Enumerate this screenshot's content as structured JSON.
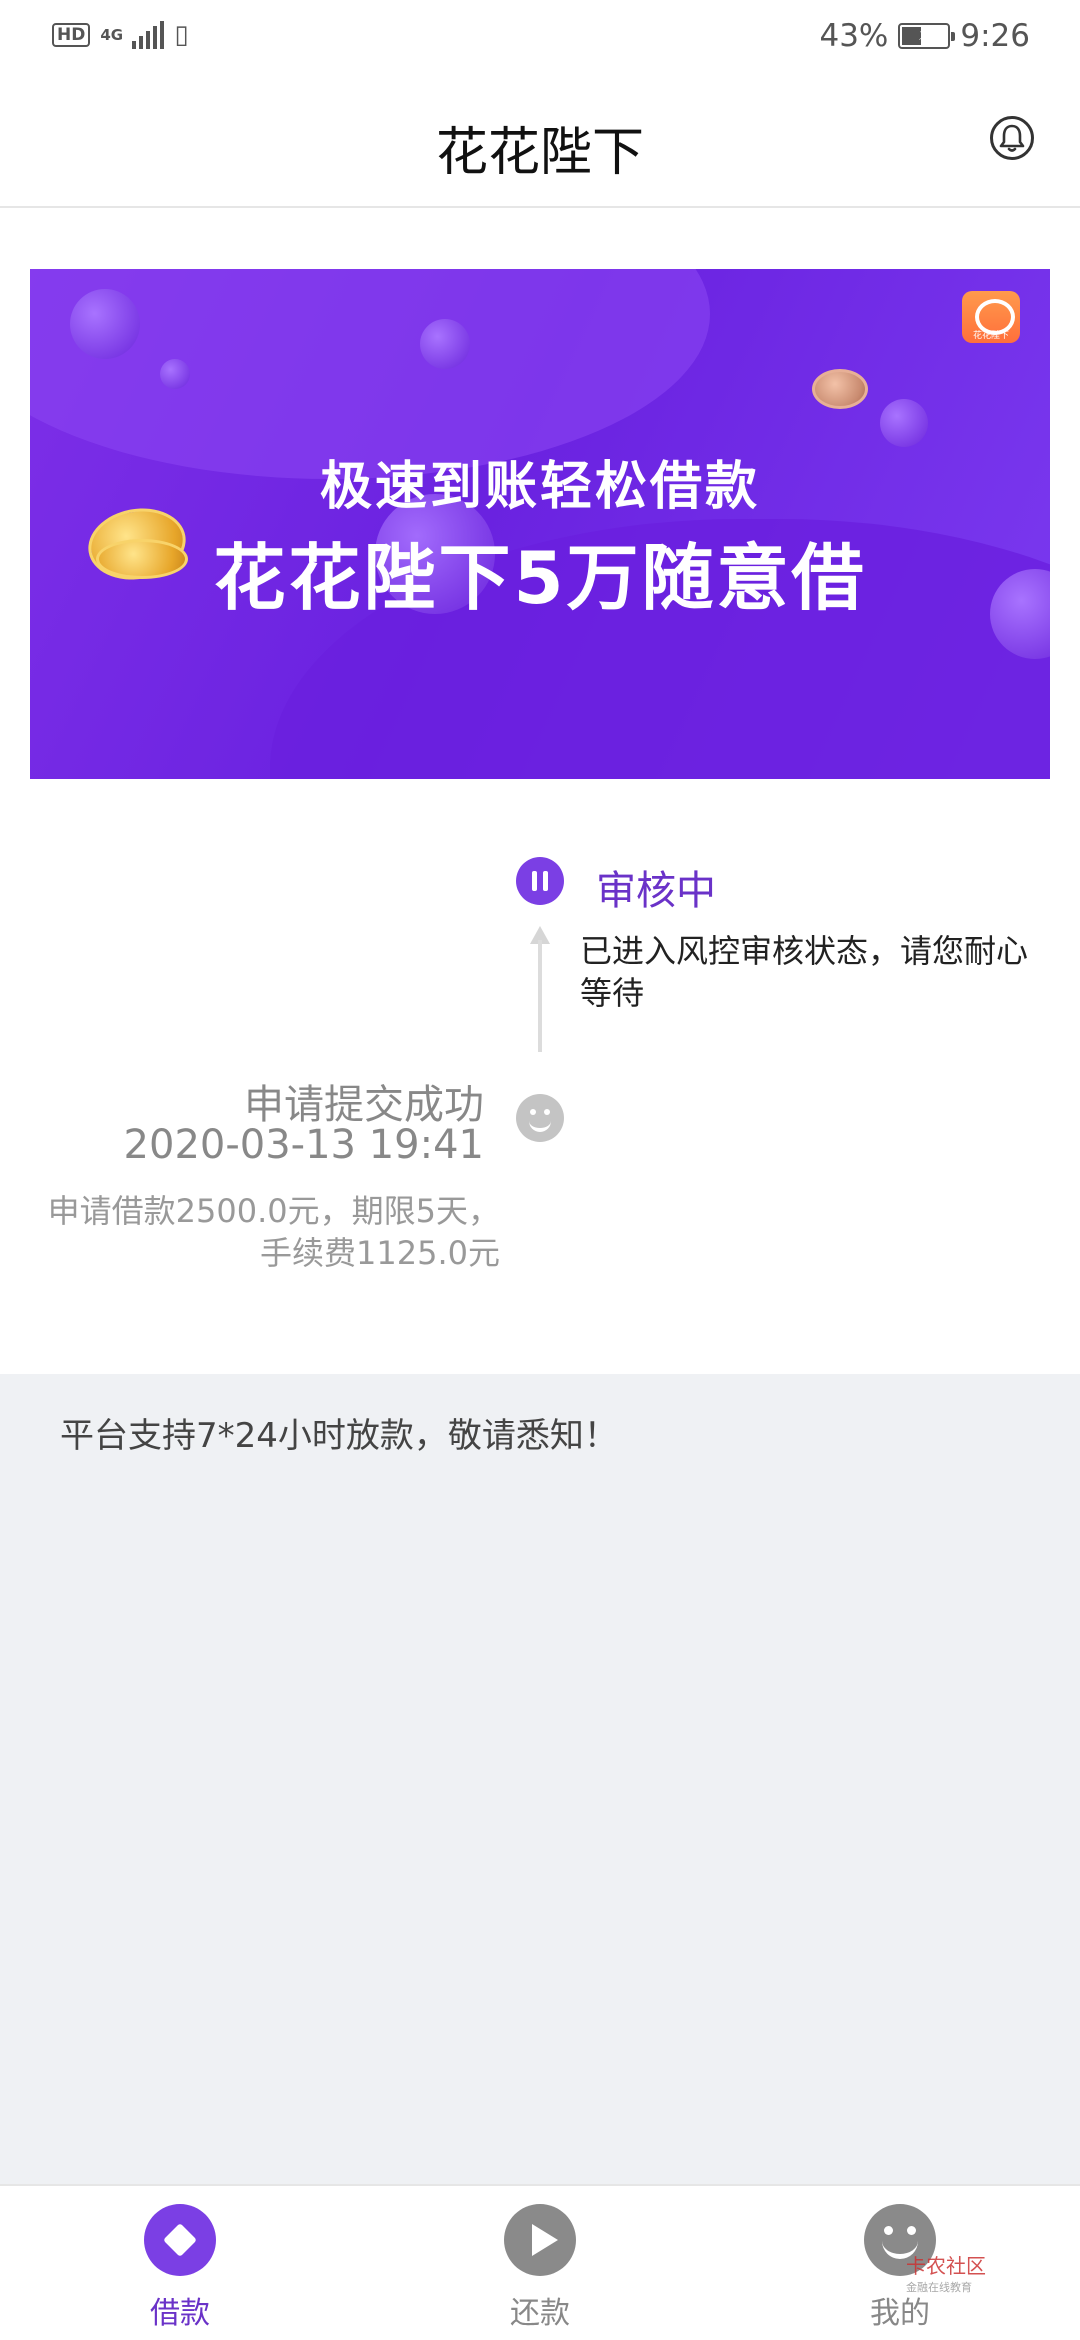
{
  "status_bar": {
    "hd": "HD",
    "network": "4G",
    "battery_percent": "43%",
    "battery_level": 0.43,
    "time": "9:26"
  },
  "header": {
    "title": "花花陛下",
    "bell_icon": "bell-icon"
  },
  "banner": {
    "line1": "极速到账轻松借款",
    "line2": "花花陛下5万随意借",
    "logo_text": "花花陛下"
  },
  "timeline": {
    "current": {
      "title": "审核中",
      "desc": "已进入风控审核状态，请您耐心等待",
      "icon": "pause-icon"
    },
    "submitted": {
      "title": "申请提交成功",
      "time": "2020-03-13 19:41",
      "desc": "申请借款2500.0元，期限5天，手续费1125.0元",
      "icon": "smile-icon"
    }
  },
  "notice": "平台支持7*24小时放款，敬请悉知！",
  "bottom_nav": {
    "items": [
      {
        "label": "借款",
        "icon": "diamond-icon",
        "active": true
      },
      {
        "label": "还款",
        "icon": "play-icon",
        "active": false
      },
      {
        "label": "我的",
        "icon": "smile-face-icon",
        "active": false
      }
    ]
  },
  "watermark": {
    "title": "卡农社区",
    "subtitle": "金融在线教育"
  },
  "colors": {
    "accent": "#7b3fe4",
    "accent_text": "#6a32c8",
    "inactive": "#8a8a8a",
    "notice_bg": "#eff1f4"
  }
}
